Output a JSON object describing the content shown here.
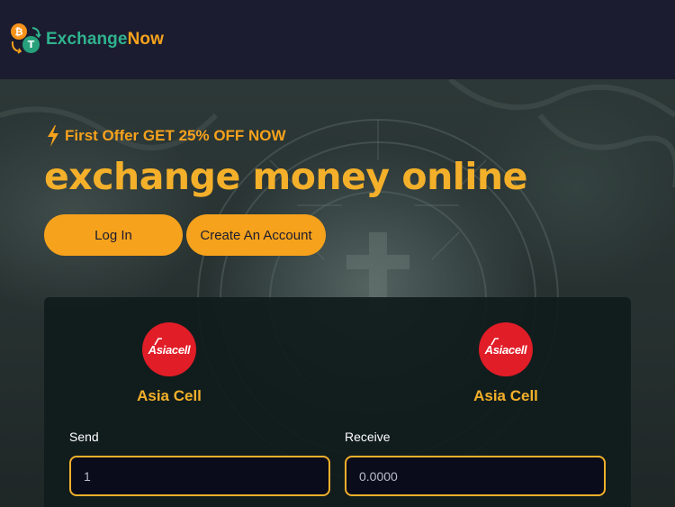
{
  "brand": {
    "name_part1": "Exchange",
    "name_part2": "Now",
    "icon": "btc-usdt-exchange-logo",
    "colors": {
      "green": "#2fb38e",
      "orange": "#f7a21c"
    }
  },
  "hero": {
    "offer_icon": "lightning-bolt-icon",
    "offer_text": "First Offer GET 25% OFF NOW",
    "headline": "exchange money online",
    "buttons": {
      "login": "Log In",
      "create_account": "Create An Account"
    }
  },
  "exchange": {
    "send_provider": {
      "name": "Asia Cell",
      "logo_text": "Asiacell"
    },
    "receive_provider": {
      "name": "Asia Cell",
      "logo_text": "Asiacell"
    },
    "send": {
      "label": "Send",
      "value": "1"
    },
    "receive": {
      "label": "Receive",
      "value": "0.0000"
    }
  },
  "colors": {
    "accent": "#f7a21c",
    "header_bg": "#1b1c2f",
    "card_bg": "#101c1c",
    "asiacell_red": "#e11d27"
  }
}
